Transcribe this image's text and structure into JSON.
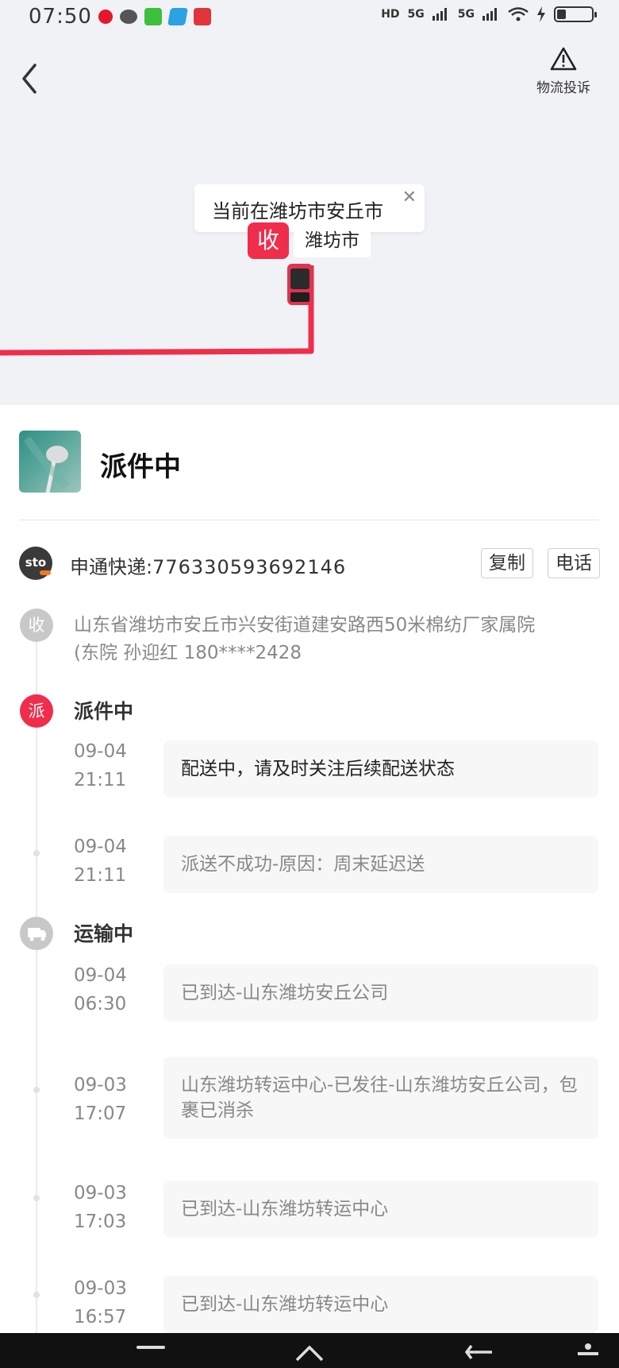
{
  "status_bar": {
    "time": "07:50",
    "network_1": "HD",
    "network_2": "5G",
    "network_3": "5G",
    "battery_level": 0.25
  },
  "map": {
    "complaint_label": "物流投诉",
    "bubble_text": "当前在潍坊市安丘市",
    "bubble_close": "✕",
    "receiver_badge": "收",
    "city_label": "潍坊市"
  },
  "header": {
    "status": "派件中"
  },
  "courier": {
    "logo_text": "sto",
    "name": "申通快递:",
    "tracking_number": "776330593692146",
    "copy_label": "复制",
    "call_label": "电话"
  },
  "timeline": {
    "receiver_badge": "收",
    "address_line1": "山东省潍坊市安丘市兴安街道建安路西50米棉纺厂家属院",
    "address_line2": "(东院 孙迎红 180****2428",
    "delivering": {
      "badge": "派",
      "title": "派件中",
      "events": [
        {
          "date": "09-04",
          "time": "21:11",
          "text": "配送中，请及时关注后续配送状态"
        },
        {
          "date": "09-04",
          "time": "21:11",
          "text": "派送不成功-原因：周末延迟送"
        }
      ]
    },
    "transit": {
      "title": "运输中",
      "events": [
        {
          "date": "09-04",
          "time": "06:30",
          "text": "已到达-山东潍坊安丘公司"
        },
        {
          "date": "09-03",
          "time": "17:07",
          "text": "山东潍坊转运中心-已发往-山东潍坊安丘公司，包裹已消杀"
        },
        {
          "date": "09-03",
          "time": "17:03",
          "text": "已到达-山东潍坊转运中心"
        },
        {
          "date": "09-03",
          "time": "16:57",
          "text": "已到达-山东潍坊转运中心"
        }
      ]
    }
  },
  "colors": {
    "accent": "#f02d4b",
    "map_bg": "#f1f2f6"
  }
}
